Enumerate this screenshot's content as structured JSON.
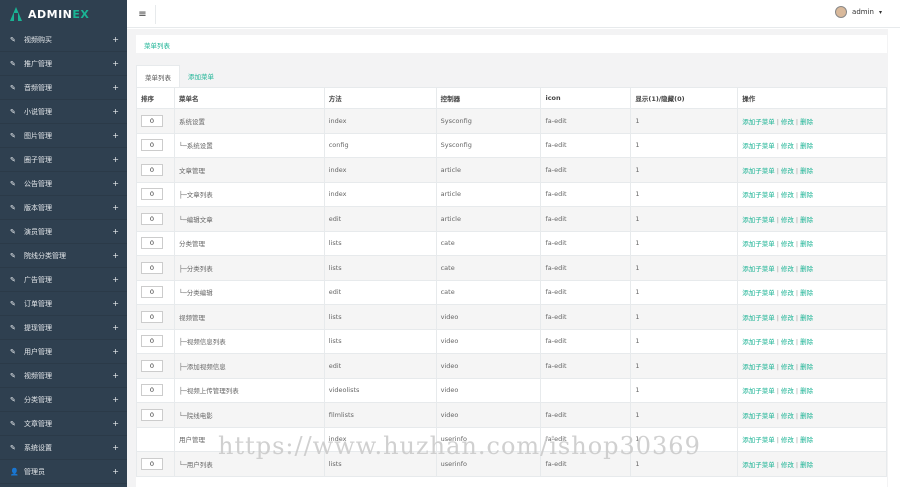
{
  "brand": {
    "prefix": "ADMIN",
    "suffix": "EX"
  },
  "topbar": {
    "menu_icon": "≡",
    "username": "admin",
    "caret": "▾"
  },
  "sidebar": {
    "items": [
      {
        "icon": "edit-icon",
        "glyph": "✎",
        "label": "视频购买",
        "plus": "+"
      },
      {
        "icon": "edit-icon",
        "glyph": "✎",
        "label": "推广管理",
        "plus": "+"
      },
      {
        "icon": "edit-icon",
        "glyph": "✎",
        "label": "音频管理",
        "plus": "+"
      },
      {
        "icon": "edit-icon",
        "glyph": "✎",
        "label": "小说管理",
        "plus": "+"
      },
      {
        "icon": "edit-icon",
        "glyph": "✎",
        "label": "图片管理",
        "plus": "+"
      },
      {
        "icon": "edit-icon",
        "glyph": "✎",
        "label": "圈子管理",
        "plus": "+"
      },
      {
        "icon": "edit-icon",
        "glyph": "✎",
        "label": "公告管理",
        "plus": "+"
      },
      {
        "icon": "edit-icon",
        "glyph": "✎",
        "label": "版本管理",
        "plus": "+"
      },
      {
        "icon": "edit-icon",
        "glyph": "✎",
        "label": "演员管理",
        "plus": "+"
      },
      {
        "icon": "edit-icon",
        "glyph": "✎",
        "label": "院线分类管理",
        "plus": "+"
      },
      {
        "icon": "edit-icon",
        "glyph": "✎",
        "label": "广告管理",
        "plus": "+"
      },
      {
        "icon": "edit-icon",
        "glyph": "✎",
        "label": "订单管理",
        "plus": "+"
      },
      {
        "icon": "edit-icon",
        "glyph": "✎",
        "label": "提现管理",
        "plus": "+"
      },
      {
        "icon": "edit-icon",
        "glyph": "✎",
        "label": "用户管理",
        "plus": "+"
      },
      {
        "icon": "edit-icon",
        "glyph": "✎",
        "label": "视频管理",
        "plus": "+"
      },
      {
        "icon": "edit-icon",
        "glyph": "✎",
        "label": "分类管理",
        "plus": "+"
      },
      {
        "icon": "edit-icon",
        "glyph": "✎",
        "label": "文章管理",
        "plus": "+"
      },
      {
        "icon": "edit-icon",
        "glyph": "✎",
        "label": "系统设置",
        "plus": "+"
      },
      {
        "icon": "user-icon",
        "glyph": "👤",
        "label": "管理员",
        "plus": "+"
      }
    ]
  },
  "breadcrumb": "菜单列表",
  "tabs": [
    {
      "label": "菜单列表",
      "active": true
    },
    {
      "label": "添加菜单",
      "active": false
    }
  ],
  "table": {
    "headers": [
      "排序",
      "菜单名",
      "方法",
      "控制器",
      "icon",
      "显示(1)/隐藏(0)",
      "操作"
    ],
    "ops": {
      "add": "添加子菜单",
      "edit": "修改",
      "delete": "删除",
      "sep": "|"
    },
    "rows": [
      {
        "sort": "0",
        "name": "系统设置",
        "method": "index",
        "controller": "Sysconfig",
        "icon": "fa-edit",
        "show": "1"
      },
      {
        "sort": "0",
        "name": "└─系统设置",
        "method": "config",
        "controller": "Sysconfig",
        "icon": "fa-edit",
        "show": "1"
      },
      {
        "sort": "0",
        "name": "文章管理",
        "method": "index",
        "controller": "article",
        "icon": "fa-edit",
        "show": "1"
      },
      {
        "sort": "0",
        "name": "├─文章列表",
        "method": "index",
        "controller": "article",
        "icon": "fa-edit",
        "show": "1"
      },
      {
        "sort": "0",
        "name": "└─编辑文章",
        "method": "edit",
        "controller": "article",
        "icon": "fa-edit",
        "show": "1"
      },
      {
        "sort": "0",
        "name": "分类管理",
        "method": "lists",
        "controller": "cate",
        "icon": "fa-edit",
        "show": "1"
      },
      {
        "sort": "0",
        "name": "├─分类列表",
        "method": "lists",
        "controller": "cate",
        "icon": "fa-edit",
        "show": "1"
      },
      {
        "sort": "0",
        "name": "└─分类编辑",
        "method": "edit",
        "controller": "cate",
        "icon": "fa-edit",
        "show": "1"
      },
      {
        "sort": "0",
        "name": "视频管理",
        "method": "lists",
        "controller": "video",
        "icon": "fa-edit",
        "show": "1"
      },
      {
        "sort": "0",
        "name": "├─视频信息列表",
        "method": "lists",
        "controller": "video",
        "icon": "fa-edit",
        "show": "1"
      },
      {
        "sort": "0",
        "name": "├─添加视频信息",
        "method": "edit",
        "controller": "video",
        "icon": "fa-edit",
        "show": "1"
      },
      {
        "sort": "0",
        "name": "├─视频上传管理列表",
        "method": "videolists",
        "controller": "video",
        "icon": "",
        "show": "1"
      },
      {
        "sort": "0",
        "name": "└─院线电影",
        "method": "filmlists",
        "controller": "video",
        "icon": "fa-edit",
        "show": "1"
      },
      {
        "sort": "",
        "name": "用户管理",
        "method": "index",
        "controller": "userinfo",
        "icon": "fa-edit",
        "show": "1"
      },
      {
        "sort": "0",
        "name": "└─用户列表",
        "method": "lists",
        "controller": "userinfo",
        "icon": "fa-edit",
        "show": "1"
      }
    ]
  },
  "watermark": "https://www.huzhan.com/ishop30369",
  "colors": {
    "sidebar": "#2f4050",
    "accent": "#1ab394",
    "content_bg": "#f3f3f4"
  }
}
